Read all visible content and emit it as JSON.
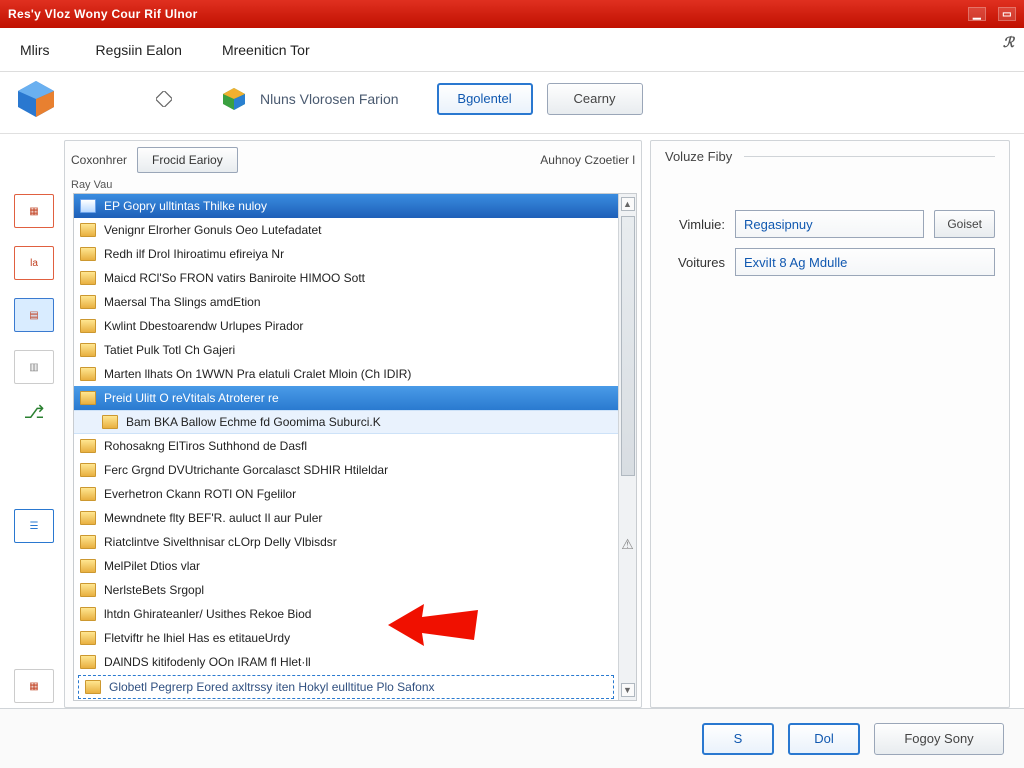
{
  "window": {
    "title": "Res'y Vloz Wony Cour Rif Ulnor"
  },
  "menu": {
    "items": [
      "Mlirs",
      "Regsiin Ealon",
      "Mreeniticn Tor"
    ]
  },
  "toolbar": {
    "label": "Nluns Vlorosen Farion",
    "primary_btn": "Bgolentel",
    "secondary_btn": "Cearny"
  },
  "left": {
    "top_label": "Coxonhrer",
    "top_btn": "Frocid Earioy",
    "aux_label": "Auhnoy Czoetier l",
    "sub_label": "Ray Vau"
  },
  "list": {
    "items": [
      {
        "label": "EP Gopry ulltintas Thilke nuloy",
        "kind": "header"
      },
      {
        "label": "Venignr Elrorher Gonuls Oeo Lutefadatet"
      },
      {
        "label": "Redh ilf Drol Ihiroatimu efireiya Nr"
      },
      {
        "label": "Maicd RCl'So FRON vatirs Baniroite HIMOO Sott"
      },
      {
        "label": "Maersal Tha Slings amdEtion"
      },
      {
        "label": "Kwlint Dbestoarendw Urlupes Pirador"
      },
      {
        "label": "Tatiet Pulk Totl Ch Gajeri"
      },
      {
        "label": "Marten llhats On 1WWN Pra elatuli Cralet Mloin (Ch IDIR)"
      },
      {
        "label": "Preid Ulitt O reVtitals Atroterer re",
        "kind": "selected"
      },
      {
        "label": "Bam BKA Ballow Echme fd Goomima Suburci.K",
        "kind": "sub"
      },
      {
        "label": "Rohosakng ElTiros Suthhond de Dasfl"
      },
      {
        "label": "Ferc Grgnd DVUtrichante Gorcalasct SDHIR Htileldar"
      },
      {
        "label": "Everhetron Ckann ROTl ON Fgelilor"
      },
      {
        "label": "Mewndnete flty BEF'R. auluct Il aur Puler"
      },
      {
        "label": "Riatclintve Sivelthnisar cLOrp Delly Vlbisdsr"
      },
      {
        "label": "MelPilet Dtios vlar"
      },
      {
        "label": "NerlsteBets Srgopl"
      },
      {
        "label": "lhtdn Ghirateanler/ Usithes Rekoe Biod"
      },
      {
        "label": "Fletviftr he lhiel Has es etitaueUrdy",
        "kind": "marker"
      },
      {
        "label": "DAlNDS kitifodenly OOn IRAM fl            Hlet·ll"
      },
      {
        "label": "Globetl Pegrerp Eored axltrssy iten Hokyl eulltitue Plo Safonx",
        "kind": "last"
      }
    ]
  },
  "right": {
    "group_title": "Voluze Fiby",
    "field1_label": "Vimluie:",
    "field1_value": "Regasipnuy",
    "field1_btn": "Goiset",
    "field2_label": "Voitures",
    "field2_value": "ExviIt 8 Ag Mdulle"
  },
  "footer": {
    "btn1": "S",
    "btn2": "Dol",
    "btn3": "Fogoy Sony"
  },
  "icons": {
    "close": "✕"
  }
}
